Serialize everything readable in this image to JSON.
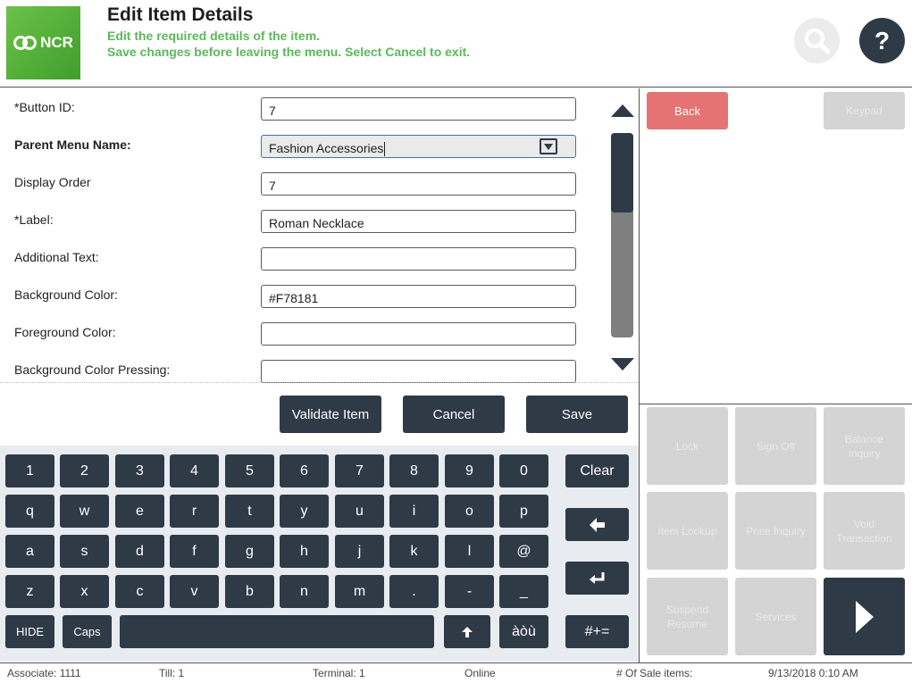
{
  "header": {
    "logo_text": "NCR",
    "title": "Edit Item Details",
    "subtitle_1": "Edit the required details of the item.",
    "subtitle_2": "Save changes before leaving the menu. Select Cancel to exit.",
    "help_label": "?"
  },
  "form": {
    "fields": [
      {
        "label": "*Button ID:",
        "value": "7"
      },
      {
        "label": "Parent Menu Name:",
        "value": "Fashion Accessories"
      },
      {
        "label": "Display Order",
        "value": "7"
      },
      {
        "label": "*Label:",
        "value": "Roman Necklace"
      },
      {
        "label": "Additional Text:",
        "value": ""
      },
      {
        "label": "Background Color:",
        "value": "#F78181"
      },
      {
        "label": "Foreground Color:",
        "value": ""
      },
      {
        "label": "Background Color Pressing:",
        "value": ""
      }
    ]
  },
  "actions": {
    "validate": "Validate Item",
    "cancel": "Cancel",
    "save": "Save"
  },
  "keyboard": {
    "row1": [
      "1",
      "2",
      "3",
      "4",
      "5",
      "6",
      "7",
      "8",
      "9",
      "0"
    ],
    "row2": [
      "q",
      "w",
      "e",
      "r",
      "t",
      "y",
      "u",
      "i",
      "o",
      "p"
    ],
    "row3": [
      "a",
      "s",
      "d",
      "f",
      "g",
      "h",
      "j",
      "k",
      "l",
      "@"
    ],
    "row4": [
      "z",
      "x",
      "c",
      "v",
      "b",
      "n",
      "m",
      ".",
      "-",
      "_"
    ],
    "hide": "HIDE",
    "caps": "Caps",
    "accents": "àòù",
    "clear": "Clear",
    "symbols": "#+="
  },
  "right_panel": {
    "back": "Back",
    "keypad": "Keypad",
    "functions": [
      "Lock",
      "Sign Off",
      "Balance Inquiry",
      "Item Lookup",
      "Price Inquiry",
      "Void Transaction",
      "Suspend Resume",
      "Services"
    ]
  },
  "status_bar": {
    "associate": "Associate: 1111",
    "till": "Till: 1",
    "terminal": "Terminal: 1",
    "status": "Online",
    "sale_items": "# Of Sale items:",
    "datetime": "9/13/2018 0:10 AM"
  },
  "colors": {
    "accent_green": "#5cb85c",
    "dark_button": "#2f3a47",
    "back_button": "#e57373",
    "disabled_button": "#d4d4d4"
  }
}
